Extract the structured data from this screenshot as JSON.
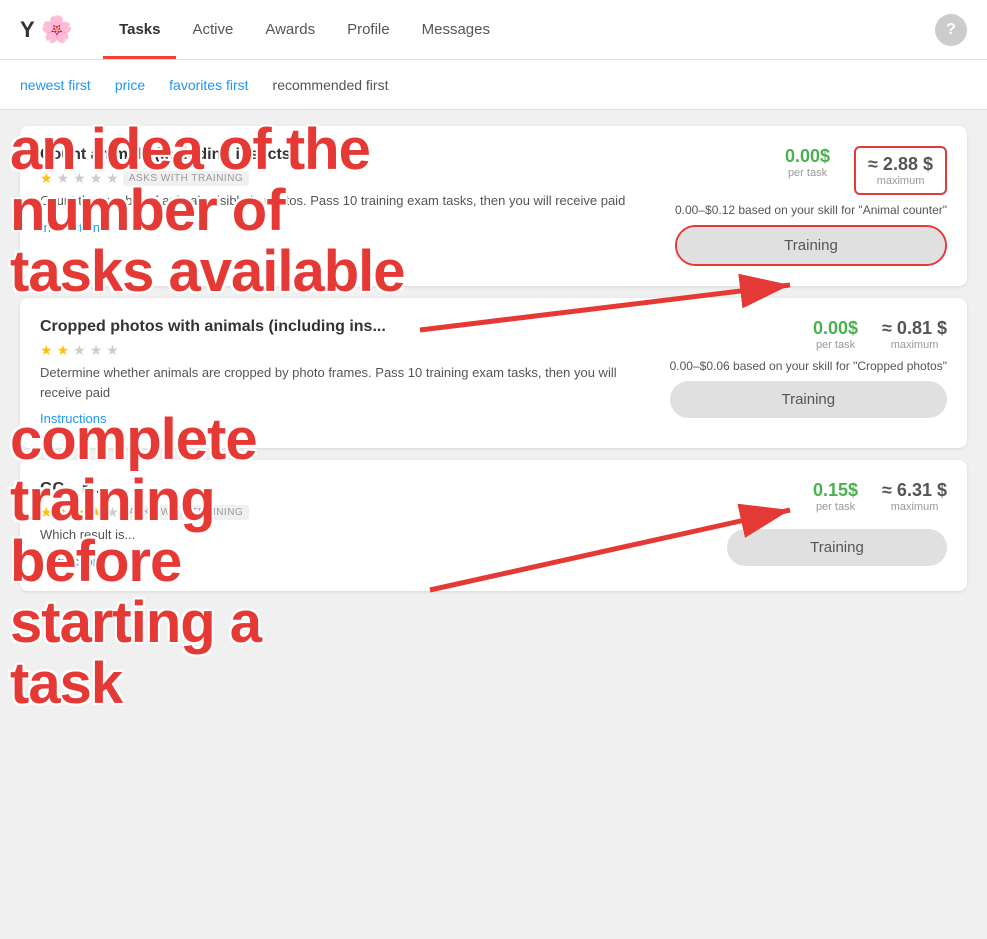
{
  "app": {
    "logo_y": "Y",
    "logo_flower": "🌸"
  },
  "nav": {
    "items": [
      {
        "label": "Tasks",
        "active": true
      },
      {
        "label": "Active",
        "active": false
      },
      {
        "label": "Awards",
        "active": false
      },
      {
        "label": "Profile",
        "active": false
      },
      {
        "label": "Messages",
        "active": false
      }
    ],
    "help_label": "?"
  },
  "subnav": {
    "items": [
      {
        "label": "newest first",
        "style": "link"
      },
      {
        "label": "price",
        "style": "link"
      },
      {
        "label": "favorites first",
        "style": "link"
      },
      {
        "label": "recommended first",
        "style": "plain"
      }
    ]
  },
  "annotation": {
    "line1": "an idea of the",
    "line2": "number of",
    "line3": "tasks available",
    "line4": "complete",
    "line5": "training",
    "line6": "before",
    "line7": "starting a",
    "line8": "task"
  },
  "tasks": [
    {
      "title": "Count animals (including insects)",
      "stars": 1,
      "total_stars": 5,
      "badge": "ASKS WITH TRAINING",
      "description": "Count the number of animals visible in photos. Pass 10 training exam tasks, then you will receive paid",
      "link": "Instructions",
      "per_task_value": "0.00",
      "per_task_currency": "$",
      "per_task_label": "per task",
      "max_value": "≈ 2.88",
      "max_currency": "$",
      "max_label": "maximum",
      "skill_info": "0.00–$0.12 based on your skill for \"Animal counter\"",
      "button_label": "Training",
      "button_highlighted": true
    },
    {
      "title": "Cropped photos with animals (including ins...",
      "stars": 2,
      "total_stars": 5,
      "badge": "",
      "description": "Determine whether animals are cropped by photo frames. Pass 10 training exam tasks, then you will receive paid",
      "link": "Instructions",
      "per_task_value": "0.00",
      "per_task_currency": "$",
      "per_task_label": "per task",
      "max_value": "≈ 0.81",
      "max_currency": "$",
      "max_label": "maximum",
      "skill_info": "0.00–$0.06 based on your skill for \"Cropped photos\"",
      "button_label": "Training",
      "button_highlighted": false
    },
    {
      "title": "GC... r...",
      "stars": 4,
      "total_stars": 5,
      "badge": "ASKS WITH TRAINING",
      "description": "Which result is...",
      "link": "Instructions",
      "per_task_value": "0.15",
      "per_task_currency": "$",
      "per_task_label": "per task",
      "max_value": "≈ 6.31",
      "max_currency": "$",
      "max_label": "maximum",
      "skill_info": "",
      "button_label": "Training",
      "button_highlighted": false
    }
  ]
}
